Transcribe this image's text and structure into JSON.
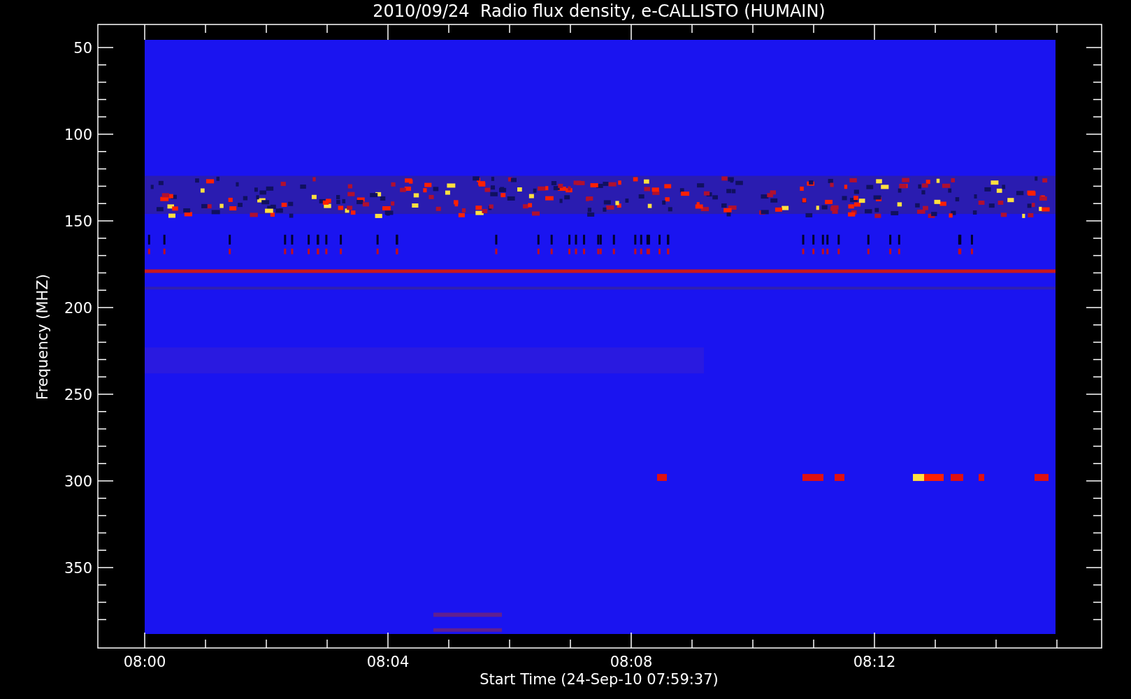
{
  "title": "2010/09/24  Radio flux density, e-CALLISTO (HUMAIN)",
  "plot": {
    "ylabel": "Frequency (MHZ)",
    "xlabel": "Start Time (24-Sep-10 07:59:37)",
    "yticks": [
      "50",
      "100",
      "150",
      "200",
      "250",
      "300",
      "350"
    ],
    "xticks": [
      "08:00",
      "08:04",
      "08:08",
      "08:12"
    ]
  }
}
